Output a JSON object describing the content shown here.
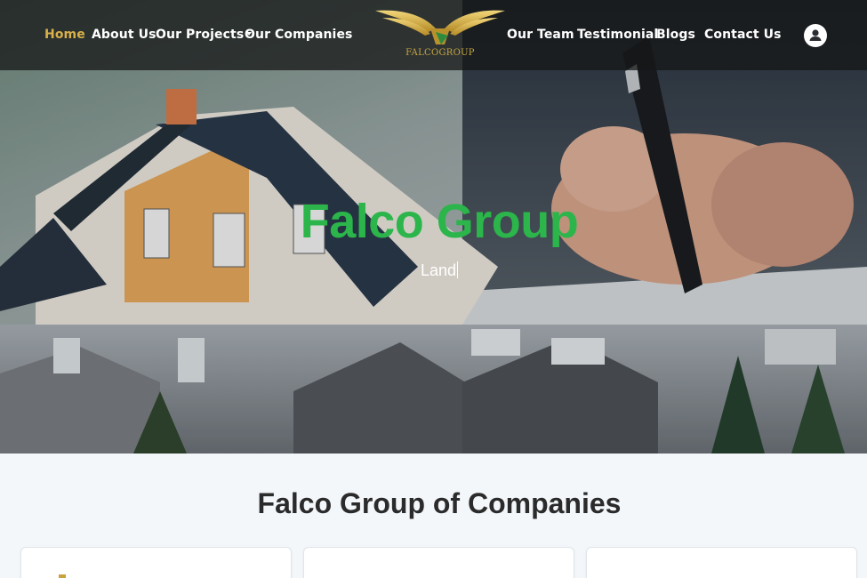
{
  "nav": {
    "left_items": [
      {
        "label": "Home",
        "active": true
      },
      {
        "label": "About Us"
      },
      {
        "label": "Our Projects",
        "has_dropdown": true
      },
      {
        "label": "Our Companies"
      }
    ],
    "right_items": [
      {
        "label": "Our Team"
      },
      {
        "label": "Testimonial"
      },
      {
        "label": "Blogs"
      },
      {
        "label": "Contact Us"
      }
    ],
    "logo_text": "FALCOGROUP",
    "user_icon": "user-avatar-icon"
  },
  "hero": {
    "title": "Falco Group",
    "subtitle": "Land"
  },
  "companies": {
    "heading": "Falco Group of Companies"
  },
  "colors": {
    "accent_gold": "#d9b04a",
    "brand_green": "#2bb54a",
    "nav_bg": "#141616"
  }
}
